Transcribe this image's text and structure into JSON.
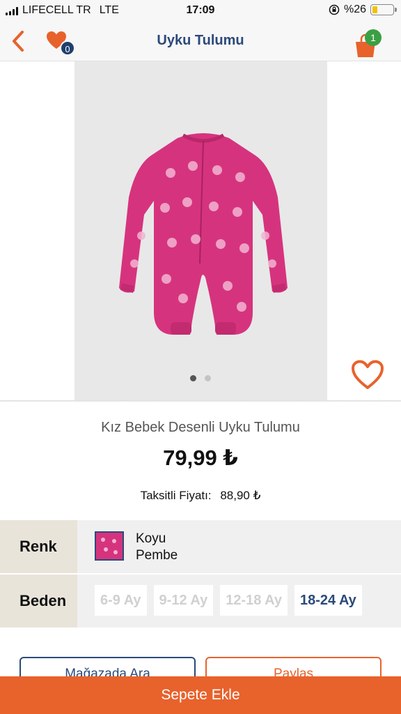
{
  "status_bar": {
    "carrier": "LIFECELL TR",
    "network": "LTE",
    "time": "17:09",
    "battery": "%26",
    "battery_level": 0.26
  },
  "nav": {
    "title": "Uyku Tulumu",
    "favorites_count": "0",
    "cart_count": "1"
  },
  "gallery": {
    "image_alt": "pink patterned baby sleepsuit",
    "dots": 2,
    "active_index": 0
  },
  "product": {
    "name": "Kız Bebek Desenli Uyku Tulumu",
    "price": "79,99 ₺",
    "installment_label": "Taksitli Fiyatı:",
    "installment_price": "88,90 ₺"
  },
  "options": {
    "color_label": "Renk",
    "color_name_line1": "Koyu",
    "color_name_line2": "Pembe",
    "size_label": "Beden",
    "sizes": [
      "6-9 Ay",
      "9-12 Ay",
      "12-18 Ay",
      "18-24 Ay"
    ],
    "selected_size": "18-24 Ay"
  },
  "actions": {
    "store_label": "Mağazada Ara",
    "share_label": "Paylaş",
    "add_to_cart_label": "Sepete Ekle"
  },
  "colors": {
    "brand_orange": "#e8622c",
    "brand_navy": "#2b4a7a",
    "product_pink": "#d6337e",
    "cart_badge_green": "#3aa043"
  }
}
